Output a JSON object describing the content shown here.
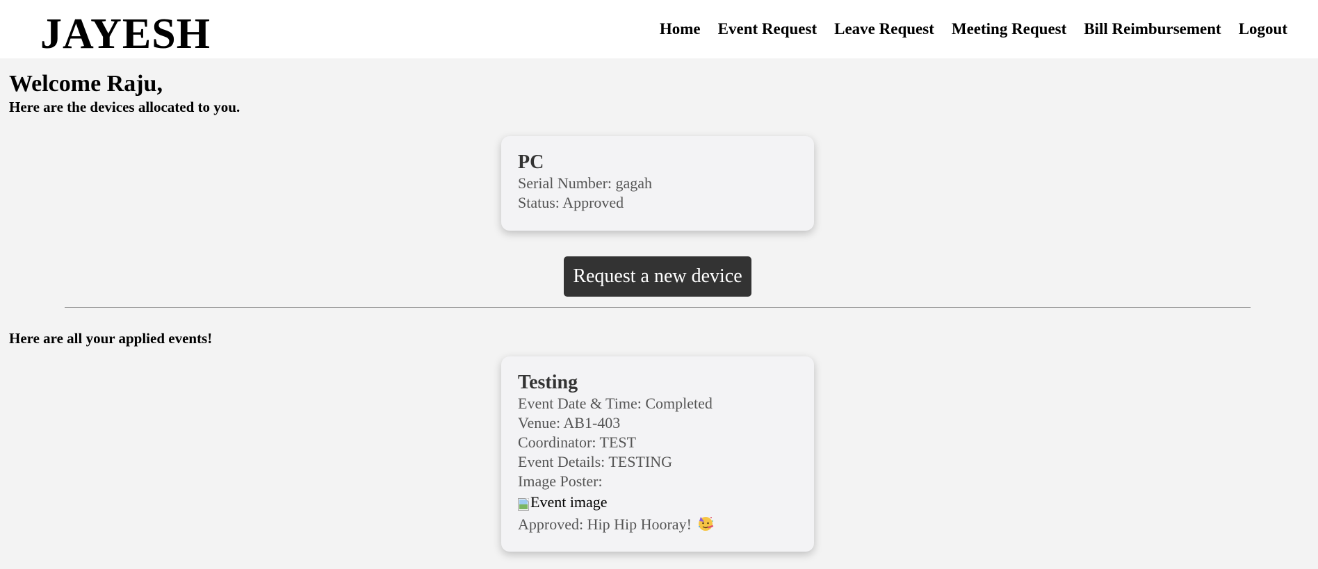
{
  "brand": "JAYESH",
  "nav": {
    "home": "Home",
    "event_request": "Event Request",
    "leave_request": "Leave Request",
    "meeting_request": "Meeting Request",
    "bill_reimbursement": "Bill Reimbursement",
    "logout": "Logout"
  },
  "welcome": "Welcome Raju,",
  "devices_heading": "Here are the devices allocated to you.",
  "device": {
    "name": "PC",
    "serial": "Serial Number: gagah",
    "status": "Status: Approved"
  },
  "request_button": "Request a new device",
  "events_heading": "Here are all your applied events!",
  "event": {
    "title": "Testing",
    "date_time": "Event Date & Time: Completed",
    "venue": "Venue: AB1-403",
    "coordinator": "Coordinator: TEST",
    "details": "Event Details: TESTING",
    "poster_label": "Image Poster:",
    "image_alt": "Event image",
    "approval": "Approved: Hip Hip Hooray!",
    "approval_icon": "party-face-icon"
  },
  "colors": {
    "navbar_bg": "#ffffff",
    "page_bg": "#f3f3f3",
    "button_bg": "#333333",
    "card_text": "#555555"
  }
}
